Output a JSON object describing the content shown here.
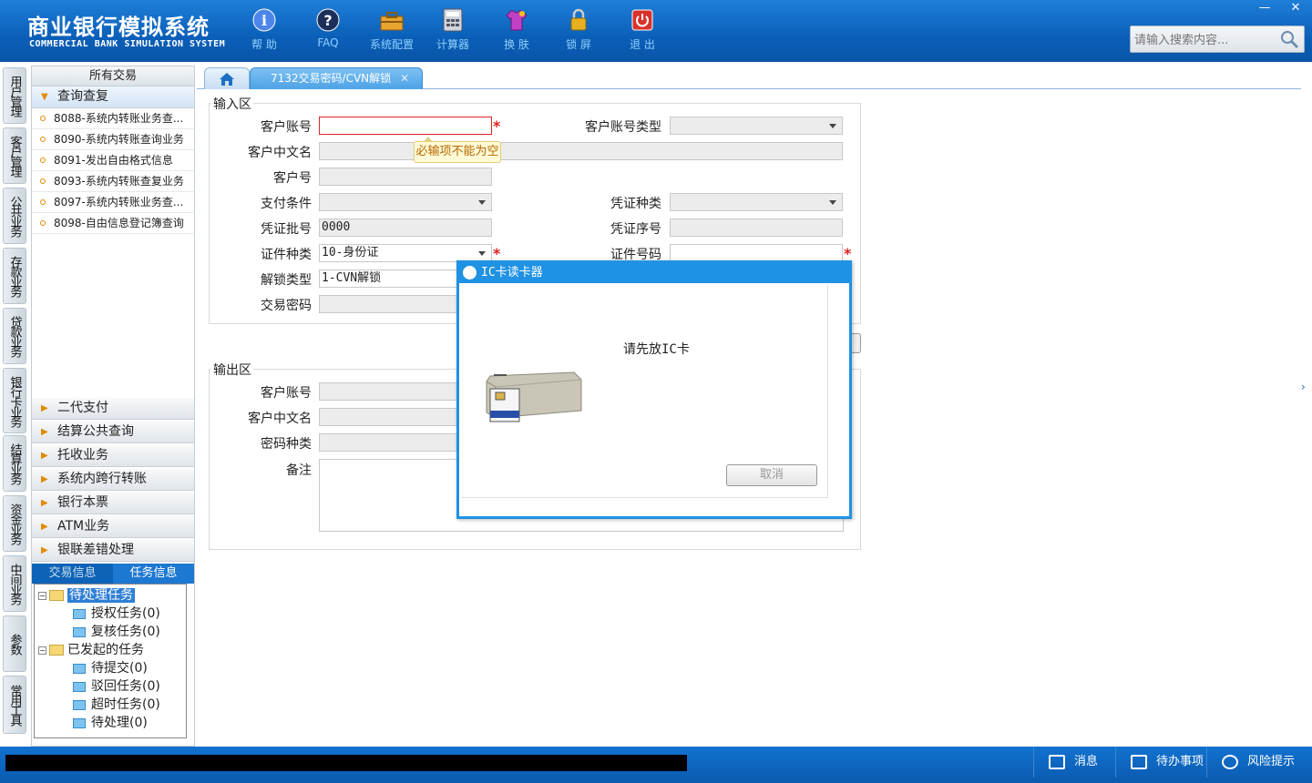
{
  "brand": {
    "title_cn": "商业银行模拟系统",
    "title_en": "COMMERCIAL BANK SIMULATION SYSTEM"
  },
  "toolbar": [
    {
      "id": "help",
      "label": "帮 助",
      "icon": "info-icon"
    },
    {
      "id": "faq",
      "label": "FAQ",
      "icon": "question-icon"
    },
    {
      "id": "config",
      "label": "系统配置",
      "icon": "toolbox-icon"
    },
    {
      "id": "calc",
      "label": "计算器",
      "icon": "calculator-icon"
    },
    {
      "id": "skin",
      "label": "换 肤",
      "icon": "shirt-icon"
    },
    {
      "id": "lock",
      "label": "锁 屏",
      "icon": "lock-icon"
    },
    {
      "id": "exit",
      "label": "退 出",
      "icon": "power-icon"
    }
  ],
  "window": {
    "minimize": "—",
    "close": "✕"
  },
  "search": {
    "placeholder": "请输入搜索内容..."
  },
  "vtabs": [
    "用户管理",
    "客户管理",
    "公共业务",
    "存款业务",
    "贷款业务",
    "银行卡业务",
    "结算业务",
    "资金业务",
    "中间业务",
    "参数",
    "常用工具"
  ],
  "sidebar": {
    "header": "所有交易",
    "open_category": "查询查复",
    "items": [
      "8088-系统内转账业务查...",
      "8090-系统内转账查询业务",
      "8091-发出自由格式信息",
      "8093-系统内转账查复业务",
      "8097-系统内转账业务查...",
      "8098-自由信息登记簿查询"
    ],
    "categories": [
      "二代支付",
      "结算公共查询",
      "托收业务",
      "系统内跨行转账",
      "银行本票",
      "ATM业务",
      "银联差错处理"
    ],
    "info_tabs": [
      "交易信息",
      "任务信息"
    ],
    "tree": {
      "pending": "待处理任务",
      "auth": "授权任务(0)",
      "review": "复核任务(0)",
      "initiated": "已发起的任务",
      "to_submit": "待提交(0)",
      "rejected": "驳回任务(0)",
      "timeout": "超时任务(0)",
      "to_process": "待处理(0)"
    }
  },
  "tabs": {
    "current": "7132交易密码/CVN解锁",
    "close": "✕"
  },
  "input_area": {
    "legend": "输入区",
    "account_label": "客户账号",
    "account_value": "",
    "account_type_label": "客户账号类型",
    "account_type_value": "",
    "cn_name_label": "客户中文名",
    "cn_name_value": "",
    "customer_no_label": "客户号",
    "customer_no_value": "",
    "pay_cond_label": "支付条件",
    "pay_cond_value": "",
    "voucher_type_label": "凭证种类",
    "voucher_type_value": "",
    "voucher_batch_label": "凭证批号",
    "voucher_batch_value": "0000",
    "voucher_seq_label": "凭证序号",
    "voucher_seq_value": "",
    "id_type_label": "证件种类",
    "id_type_value": "10-身份证",
    "id_no_label": "证件号码",
    "id_no_value": "",
    "unlock_type_label": "解锁类型",
    "unlock_type_value": "1-CVN解锁",
    "txn_pwd_label": "交易密码",
    "txn_pwd_value": "",
    "required_mark": "*",
    "error_tip": "必输项不能为空"
  },
  "output_area": {
    "legend": "输出区",
    "account_label": "客户账号",
    "cn_name_label": "客户中文名",
    "pwd_type_label": "密码种类",
    "remark_label": "备注"
  },
  "dialog": {
    "title": "IC卡读卡器",
    "message": "请先放IC卡",
    "cancel": "取消"
  },
  "footer": {
    "message": "消息",
    "todo": "待办事项",
    "risk": "风险提示"
  },
  "colors": {
    "header": "#0b5fb8",
    "accent": "#1f92e4",
    "required": "#dd2222"
  }
}
